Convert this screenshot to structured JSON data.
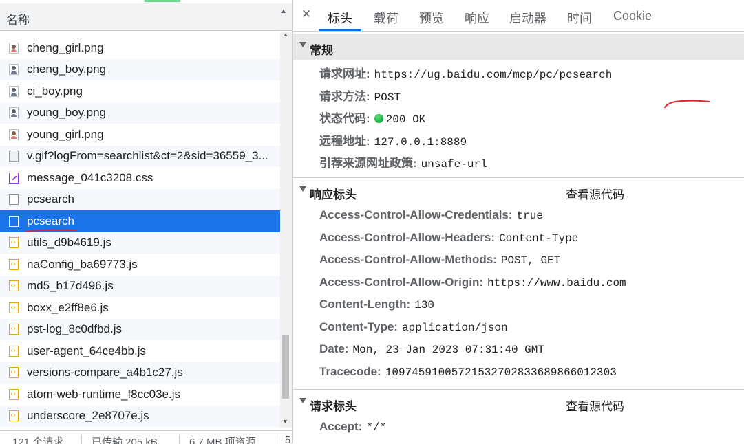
{
  "window": {
    "accent": "#1a73e8"
  },
  "left_panel": {
    "column_header": "名称",
    "files": [
      {
        "name": "cheng_girl.png",
        "icon": "image-icon"
      },
      {
        "name": "cheng_boy.png",
        "icon": "image-icon"
      },
      {
        "name": "ci_boy.png",
        "icon": "image-icon"
      },
      {
        "name": "young_boy.png",
        "icon": "image-icon"
      },
      {
        "name": "young_girl.png",
        "icon": "image-icon"
      },
      {
        "name": "v.gif?logFrom=searchlist&ct=2&sid=36559_3...",
        "icon": "gif-icon"
      },
      {
        "name": "message_041c3208.css",
        "icon": "css-icon"
      },
      {
        "name": "pcsearch",
        "icon": "document-icon"
      },
      {
        "name": "pcsearch",
        "icon": "document-icon",
        "selected": true
      },
      {
        "name": "utils_d9b4619.js",
        "icon": "js-icon"
      },
      {
        "name": "naConfig_ba69773.js",
        "icon": "js-icon"
      },
      {
        "name": "md5_b17d496.js",
        "icon": "js-icon"
      },
      {
        "name": "boxx_e2ff8e6.js",
        "icon": "js-icon"
      },
      {
        "name": "pst-log_8c0dfbd.js",
        "icon": "js-icon"
      },
      {
        "name": "user-agent_64ce4bb.js",
        "icon": "js-icon"
      },
      {
        "name": "versions-compare_a4b1c27.js",
        "icon": "js-icon"
      },
      {
        "name": "atom-web-runtime_f8cc03e.js",
        "icon": "js-icon"
      },
      {
        "name": "underscore_2e8707e.js",
        "icon": "js-icon"
      }
    ],
    "status": {
      "requests": "121 个请求",
      "transferred": "已传输 205 kB",
      "resources": "6.7 MB 项资源",
      "more": "5"
    }
  },
  "tabs": [
    "标头",
    "载荷",
    "预览",
    "响应",
    "启动器",
    "时间",
    "Cookie"
  ],
  "active_tab": "标头",
  "general": {
    "title": "常规",
    "rows": [
      {
        "k": "请求网址:",
        "v": "https://ug.baidu.com/mcp/pc/pcsearch"
      },
      {
        "k": "请求方法:",
        "v": "POST"
      },
      {
        "k": "状态代码:",
        "v": "200 OK"
      },
      {
        "k": "远程地址:",
        "v": "127.0.0.1:8889"
      },
      {
        "k": "引荐来源网址政策:",
        "v": "unsafe-url"
      }
    ],
    "status_color": "#1eb64a"
  },
  "response_headers": {
    "title": "响应标头",
    "view_source": "查看源代码",
    "rows": [
      {
        "k": "Access-Control-Allow-Credentials:",
        "v": "true"
      },
      {
        "k": "Access-Control-Allow-Headers:",
        "v": "Content-Type"
      },
      {
        "k": "Access-Control-Allow-Methods:",
        "v": "POST, GET"
      },
      {
        "k": "Access-Control-Allow-Origin:",
        "v": "https://www.baidu.com"
      },
      {
        "k": "Content-Length:",
        "v": "130"
      },
      {
        "k": "Content-Type:",
        "v": "application/json"
      },
      {
        "k": "Date:",
        "v": "Mon, 23 Jan 2023 07:31:40 GMT"
      },
      {
        "k": "Tracecode:",
        "v": "10974591005721532702833689866012303"
      }
    ]
  },
  "request_headers": {
    "title": "请求标头",
    "view_source": "查看源代码",
    "rows": [
      {
        "k": "Accept:",
        "v": "*/*"
      }
    ]
  },
  "annotation_color": "#e0262a"
}
